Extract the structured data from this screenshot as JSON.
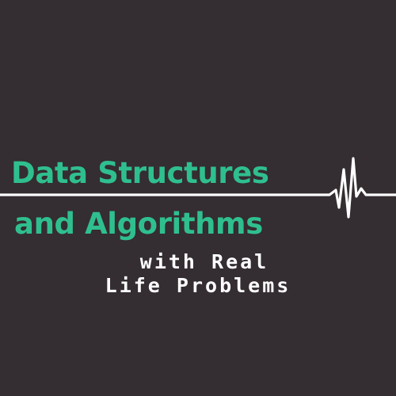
{
  "cover": {
    "title_line_1": "Data Structures",
    "title_line_2": "and Algorithms",
    "subtitle_line_1": "with Real",
    "subtitle_line_2": "Life Problems"
  },
  "colors": {
    "background": "#342d31",
    "accent": "#2fbf8f",
    "text": "#ffffff",
    "pulse_line": "#ffffff"
  },
  "icons": {
    "pulse": "heartbeat-pulse-line"
  }
}
